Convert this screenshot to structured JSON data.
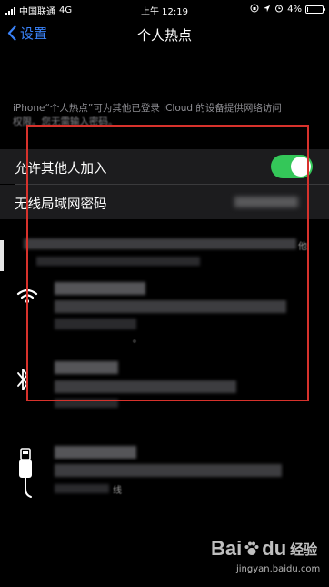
{
  "status_bar": {
    "carrier": "中国联通",
    "network": "4G",
    "time": "上午 12:19",
    "battery_percent": "4%",
    "battery_level": 0.04
  },
  "nav": {
    "back_label": "设置",
    "title": "个人热点"
  },
  "description": {
    "line1": "iPhone“个人热点”可为其他已登录 iCloud 的设备提供网络访问",
    "line2": "权限。您无需输入密码。"
  },
  "settings": {
    "allow_others_label": "允许其他人加入",
    "allow_others_on": true,
    "wifi_password_label": "无线局域网密码"
  },
  "obscured_snippets": {
    "right_fragment": "他",
    "small_fragment": "。",
    "usb_fragment": "线"
  },
  "icons": {
    "wifi": "wifi-icon",
    "bluetooth": "bluetooth-icon",
    "usb": "usb-cable-icon"
  },
  "colors": {
    "accent_blue": "#3a82f7",
    "toggle_green": "#34c759",
    "annotation_red": "#d7322c"
  },
  "watermark": {
    "brand": "Bai",
    "brand_suffix": "du",
    "chinese": "经验",
    "url": "jingyan.baidu.com"
  }
}
